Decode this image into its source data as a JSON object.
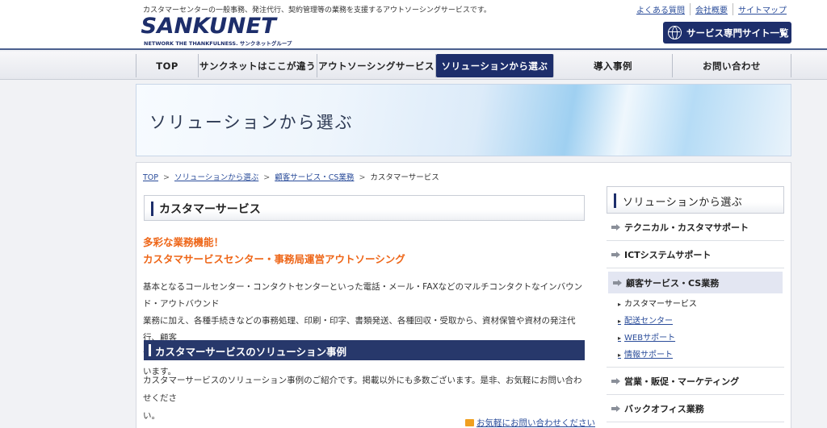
{
  "header": {
    "tagline": "カスタマーセンターの一般事務、発注代行、契約管理等の業務を支援するアウトソーシングサービスです。",
    "logo_text": "SANKUNET",
    "logo_sub": "NETWORK THE THANKFULNESS. サンクネットグループ",
    "util_links": [
      "よくある質問",
      "会社概要",
      "サイトマップ"
    ],
    "site_button": "サービス専門サイト一覧"
  },
  "nav": {
    "items": [
      "TOP",
      "サンクネットはここが違う",
      "アウトソーシングサービス",
      "ソリューションから選ぶ",
      "導入事例",
      "お問い合わせ"
    ]
  },
  "banner": {
    "title": "ソリューションから選ぶ"
  },
  "breadcrumb": {
    "items": [
      "TOP",
      "ソリューションから選ぶ",
      "顧客サービス・CS業務",
      "カスタマーサービス"
    ],
    "sep": ">"
  },
  "main": {
    "heading": "カスタマーサービス",
    "catch_line1": "多彩な業務機能！",
    "catch_line2": "カスタマサービスセンター・事務局運営アウトソーシング",
    "body_line1": "基本となるコールセンター・コンタクトセンターといった電話・メール・FAXなどのマルチコンタクトなインバウンド・アウトバウンド",
    "body_line2": "業務に加え、各種手続きなどの事務処理、印刷・印字、書類発送、各種回収・受取から、資材保管や資材の発注代行、顧客",
    "body_line3": "管理や課金、契約管理など、必要とされるさまざまな業務機能をセンター運営に集約してアウトソーシングで請け負います。",
    "subheading": "カスタマーサービスのソリューション事例",
    "body2_line1": "カスタマーサービスのソリューション事例のご紹介です。掲載以外にも多数ございます。是非、お気軽にお問い合わせくださ",
    "body2_line2": "い。",
    "contact_link": "お気軽にお問い合わせください"
  },
  "sidebar": {
    "heading": "ソリューションから選ぶ",
    "items": [
      "テクニカル・カスタマサポート",
      "ICTシステムサポート",
      "顧客サービス・CS業務"
    ],
    "subitems": [
      "カスタマーサービス",
      "配送センター",
      "WEBサポート",
      "情報サポート"
    ],
    "items_after": [
      "営業・販促・マーケティング",
      "バックオフィス業務"
    ]
  }
}
